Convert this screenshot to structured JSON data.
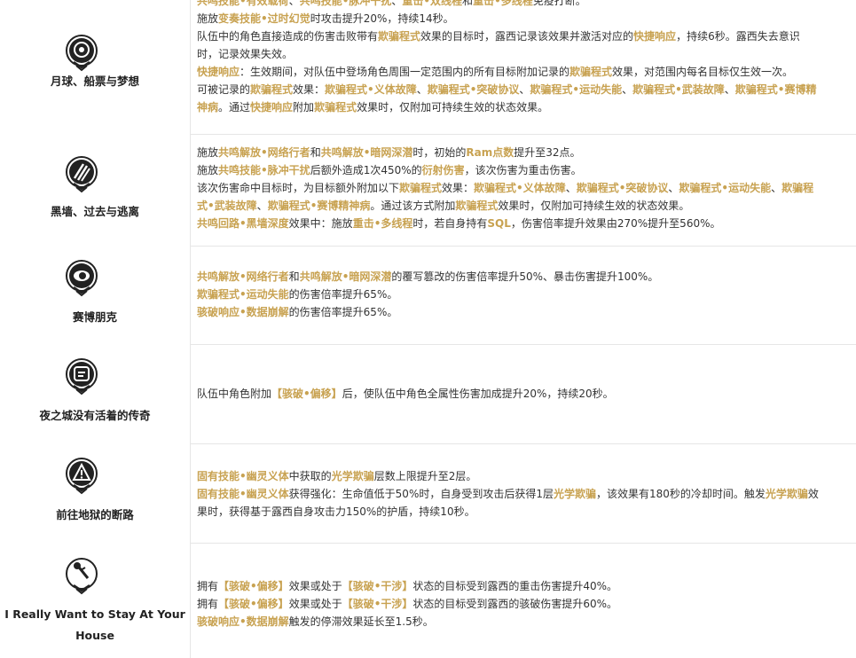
{
  "rows": [
    {
      "name": "月球、船票与梦想",
      "icon": "moon-ticket-dream-icon",
      "lines": [
        [
          {
            "h": "共鸣技能•有效载荷"
          },
          {
            "t": "、"
          },
          {
            "h": "共鸣技能•脉冲干扰"
          },
          {
            "t": "、"
          },
          {
            "h": "重击•双线程"
          },
          {
            "t": "和"
          },
          {
            "h": "重击•多线程"
          },
          {
            "t": "免疫打断。"
          }
        ],
        [
          {
            "t": "施放"
          },
          {
            "h": "变奏技能•过时幻觉"
          },
          {
            "t": "时攻击提升20%，持续14秒。"
          }
        ],
        [
          {
            "t": "队伍中的角色直接造成的伤害击败带有"
          },
          {
            "h": "欺骗程式"
          },
          {
            "t": "效果的目标时，露西记录该效果并激活对应的"
          },
          {
            "h": "快捷响应"
          },
          {
            "t": "，持续6秒。露西失去意识"
          }
        ],
        [
          {
            "t": "时，记录效果失效。"
          }
        ],
        [
          {
            "h": "快捷响应"
          },
          {
            "t": "：生效期间，对队伍中登场角色周围一定范围内的所有目标附加记录的"
          },
          {
            "h": "欺骗程式"
          },
          {
            "t": "效果，对范围内每名目标仅生效一次。"
          }
        ],
        [
          {
            "t": "可被记录的"
          },
          {
            "h": "欺骗程式"
          },
          {
            "t": "效果："
          },
          {
            "h": "欺骗程式•义体故障"
          },
          {
            "t": "、"
          },
          {
            "h": "欺骗程式•突破协议"
          },
          {
            "t": "、"
          },
          {
            "h": "欺骗程式•运动失能"
          },
          {
            "t": "、"
          },
          {
            "h": "欺骗程式•武装故障"
          },
          {
            "t": "、"
          },
          {
            "h": "欺骗程式•赛博精"
          }
        ],
        [
          {
            "h": "神病"
          },
          {
            "t": "。通过"
          },
          {
            "h": "快捷响应"
          },
          {
            "t": "附加"
          },
          {
            "h": "欺骗程式"
          },
          {
            "t": "效果时，仅附加可持续生效的状态效果。"
          }
        ]
      ]
    },
    {
      "name": "黑墙、过去与逃离",
      "icon": "blackwall-claw-icon",
      "lines": [
        [
          {
            "t": "施放"
          },
          {
            "h": "共鸣解放•网络行者"
          },
          {
            "t": "和"
          },
          {
            "h": "共鸣解放•暗网深潜"
          },
          {
            "t": "时，初始的"
          },
          {
            "h": "Ram点数"
          },
          {
            "t": "提升至32点。"
          }
        ],
        [
          {
            "t": "施放"
          },
          {
            "h": "共鸣技能•脉冲干扰"
          },
          {
            "t": "后额外造成1次450%的"
          },
          {
            "h": "衍射伤害"
          },
          {
            "t": "，该次伤害为重击伤害。"
          }
        ],
        [
          {
            "t": "该次伤害命中目标时，为目标额外附加以下"
          },
          {
            "h": "欺骗程式"
          },
          {
            "t": "效果："
          },
          {
            "h": "欺骗程式•义体故障"
          },
          {
            "t": "、"
          },
          {
            "h": "欺骗程式•突破协议"
          },
          {
            "t": "、"
          },
          {
            "h": "欺骗程式•运动失能"
          },
          {
            "t": "、"
          },
          {
            "h": "欺骗程"
          }
        ],
        [
          {
            "h": "式•武装故障"
          },
          {
            "t": "、"
          },
          {
            "h": "欺骗程式•赛博精神病"
          },
          {
            "t": "。通过该方式附加"
          },
          {
            "h": "欺骗程式"
          },
          {
            "t": "效果时，仅附加可持续生效的状态效果。"
          }
        ],
        [
          {
            "h": "共鸣回路•黑墙深度"
          },
          {
            "t": "效果中：施放"
          },
          {
            "h": "重击•多线程"
          },
          {
            "t": "时，若自身持有"
          },
          {
            "h": "SQL"
          },
          {
            "t": "，伤害倍率提升效果由270%提升至560%。"
          }
        ]
      ]
    },
    {
      "name": "赛博朋克",
      "icon": "cyberpunk-eye-icon",
      "lines": [
        [
          {
            "h": "共鸣解放•网络行者"
          },
          {
            "t": "和"
          },
          {
            "h": "共鸣解放•暗网深潜"
          },
          {
            "t": "的覆写篡改的伤害倍率提升50%、暴击伤害提升100%。"
          }
        ],
        [
          {
            "h": "欺骗程式•运动失能"
          },
          {
            "t": "的伤害倍率提升65%。"
          }
        ],
        [
          {
            "h": "骇破响应•数据崩解"
          },
          {
            "t": "的伤害倍率提升65%。"
          }
        ]
      ]
    },
    {
      "name": "夜之城没有活着的传奇",
      "icon": "night-city-legend-icon",
      "lines": [
        [
          {
            "t": "队伍中角色附加"
          },
          {
            "h": "【骇破•偏移】"
          },
          {
            "t": "后，使队伍中角色全属性伤害加成提升20%，持续20秒。"
          }
        ]
      ]
    },
    {
      "name": "前往地狱的断路",
      "icon": "hell-road-warning-icon",
      "lines": [
        [
          {
            "h": "固有技能•幽灵义体"
          },
          {
            "t": "中获取的"
          },
          {
            "h": "光学欺骗"
          },
          {
            "t": "层数上限提升至2层。"
          }
        ],
        [
          {
            "h": "固有技能•幽灵义体"
          },
          {
            "t": "获得强化：生命值低于50%时，自身受到攻击后获得1层"
          },
          {
            "h": "光学欺骗"
          },
          {
            "t": "，该效果有180秒的冷却时间。触发"
          },
          {
            "h": "光学欺骗"
          },
          {
            "t": "效"
          }
        ],
        [
          {
            "t": "果时，获得基于露西自身攻击力150%的护盾，持续10秒。"
          }
        ]
      ]
    },
    {
      "name1": "I Really Want to Stay At Your",
      "name2": "House",
      "icon": "stay-house-rose-icon",
      "lines": [
        [
          {
            "t": "拥有"
          },
          {
            "h": "【骇破•偏移】"
          },
          {
            "t": "效果或处于"
          },
          {
            "h": "【骇破•干涉】"
          },
          {
            "t": "状态的目标受到露西的重击伤害提升40%。"
          }
        ],
        [
          {
            "t": "拥有"
          },
          {
            "h": "【骇破•偏移】"
          },
          {
            "t": "效果或处于"
          },
          {
            "h": "【骇破•干涉】"
          },
          {
            "t": "状态的目标受到露西的骇破伤害提升60%。"
          }
        ],
        [
          {
            "h": "骇破响应•数据崩解"
          },
          {
            "t": "触发的停滞效果延长至1.5秒。"
          }
        ]
      ]
    }
  ]
}
